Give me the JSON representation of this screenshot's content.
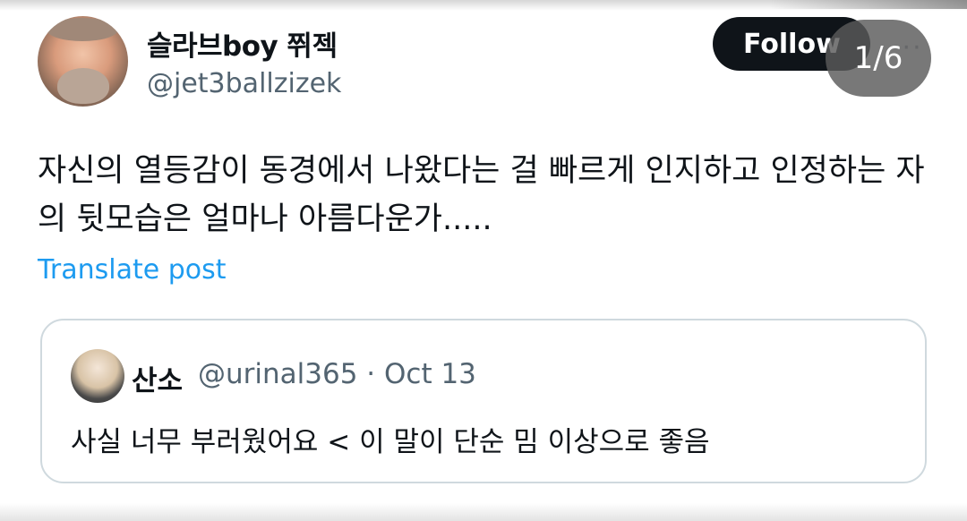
{
  "post": {
    "author": {
      "display_name": "슬라브boy 쮜젝",
      "handle": "@jet3ballzizek"
    },
    "follow_label": "Follow",
    "more_icon": "more-icon",
    "body": "자신의 열등감이 동경에서 나왔다는 걸 빠르게 인지하고 인정하는 자의 뒷모습은 얼마나 아름다운가.....",
    "translate_label": "Translate post",
    "translate_color": "#1d9bf0"
  },
  "viewer": {
    "page_counter": "1/6"
  },
  "quote": {
    "display_name": "산소",
    "handle_date": "@urinal365 · Oct 13",
    "body": "사실 너무 부러웠어요 < 이 말이 단순 밈 이상으로 좋음"
  }
}
